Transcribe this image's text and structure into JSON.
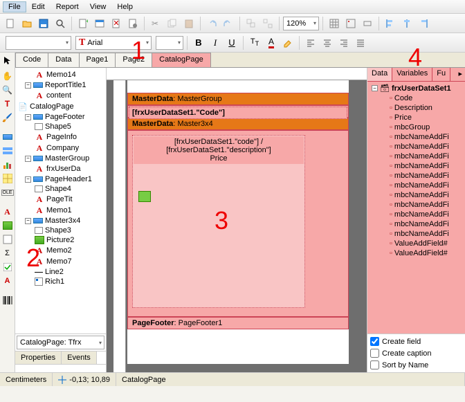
{
  "menu": {
    "items": [
      "File",
      "Edit",
      "Report",
      "View",
      "Help"
    ],
    "active": 0
  },
  "toolbar2": {
    "font": "Arial",
    "zoom": "120%",
    "size": ""
  },
  "doc_tabs": {
    "items": [
      "Code",
      "Data",
      "Page1",
      "Page2",
      "CatalogPage"
    ],
    "active": 4
  },
  "tree": [
    {
      "t": "Memo14",
      "i": "memo",
      "lv": 2
    },
    {
      "t": "ReportTitle1",
      "i": "band",
      "lv": 1,
      "exp": "-"
    },
    {
      "t": "content",
      "i": "memo",
      "lv": 2
    },
    {
      "t": "CatalogPage",
      "i": "page",
      "lv": 0
    },
    {
      "t": "PageFooter",
      "i": "band",
      "lv": 1,
      "exp": "-"
    },
    {
      "t": "Shape5",
      "i": "shape",
      "lv": 2
    },
    {
      "t": "PageInfo",
      "i": "memo",
      "lv": 2
    },
    {
      "t": "Company",
      "i": "memo",
      "lv": 2
    },
    {
      "t": "MasterGroup",
      "i": "band",
      "lv": 1,
      "exp": "-"
    },
    {
      "t": "frxUserDa",
      "i": "memo",
      "lv": 2
    },
    {
      "t": "PageHeader1",
      "i": "band",
      "lv": 1,
      "exp": "-"
    },
    {
      "t": "Shape4",
      "i": "shape",
      "lv": 2
    },
    {
      "t": "PageTit",
      "i": "memo",
      "lv": 2
    },
    {
      "t": "Memo1",
      "i": "memo",
      "lv": 2
    },
    {
      "t": "Master3x4",
      "i": "band",
      "lv": 1,
      "exp": "-"
    },
    {
      "t": "Shape3",
      "i": "shape",
      "lv": 2
    },
    {
      "t": "Picture2",
      "i": "pic",
      "lv": 2
    },
    {
      "t": "Memo2",
      "i": "memo",
      "lv": 2
    },
    {
      "t": "Memo7",
      "i": "memo",
      "lv": 2
    },
    {
      "t": "Line2",
      "i": "line",
      "lv": 2
    },
    {
      "t": "Rich1",
      "i": "rich",
      "lv": 2
    }
  ],
  "prop_combo": "CatalogPage: Tfrx",
  "prop_tabs": [
    "Properties",
    "Events"
  ],
  "bands": {
    "b1": {
      "title": "MasterData",
      "sub": "MasterGroup"
    },
    "b1_row": "[frxUserDataSet1.\"Code\"]",
    "b2": {
      "title": "MasterData",
      "sub": "Master3x4"
    },
    "b2_cell": "[frxUserDataSet1.\"code\"] /\n[frxUserDataSet1.\"description\"]\nPrice",
    "b3": {
      "title": "PageFooter",
      "sub": "PageFooter1"
    }
  },
  "right": {
    "tabs": [
      "Data",
      "Variables",
      "Fu"
    ],
    "root": "frxUserDataSet1",
    "fields": [
      "Code",
      "Description",
      "Price",
      "mbcGroup",
      "mbcNameAddFi",
      "mbcNameAddFi",
      "mbcNameAddFi",
      "mbcNameAddFi",
      "mbcNameAddFi",
      "mbcNameAddFi",
      "mbcNameAddFi",
      "mbcNameAddFi",
      "mbcNameAddFi",
      "mbcNameAddFi",
      "mbcNameAddFi",
      "ValueAddField#",
      "ValueAddField#"
    ],
    "checks": [
      "Create field",
      "Create caption",
      "Sort by Name"
    ]
  },
  "status": {
    "units": "Centimeters",
    "coords": "-0,13; 10,89",
    "page": "CatalogPage"
  },
  "annotations": {
    "a1": "1",
    "a2": "2",
    "a3": "3",
    "a4": "4"
  }
}
